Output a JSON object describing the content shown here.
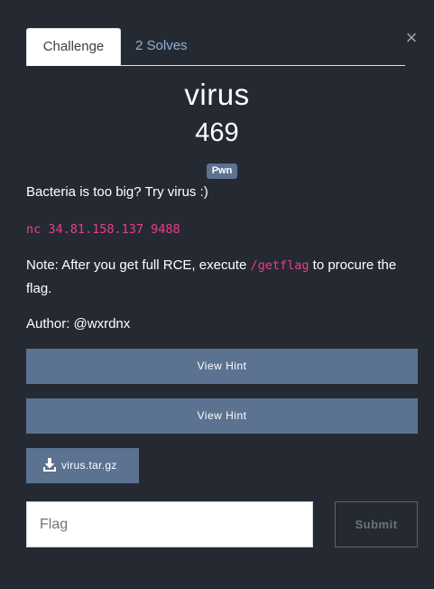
{
  "modal": {
    "close_glyph": "×"
  },
  "tabs": [
    {
      "label": "Challenge",
      "active": true
    },
    {
      "label": "2 Solves",
      "active": false
    }
  ],
  "challenge": {
    "name": "virus",
    "points": "469",
    "category_tag": "Pwn",
    "description": {
      "line1": "Bacteria is too big? Try virus :)",
      "connection": "nc 34.81.158.137 9488",
      "note_prefix": "Note: After you get full RCE, execute ",
      "note_code": "/getflag",
      "note_suffix": " to procure the flag.",
      "author": "Author: @wxrdnx"
    }
  },
  "hints": [
    {
      "label": "View Hint"
    },
    {
      "label": "View Hint"
    }
  ],
  "file": {
    "label": "virus.tar.gz",
    "icon": "download-icon"
  },
  "submit_form": {
    "flag_placeholder": "Flag",
    "flag_value": "",
    "submit_label": "Submit"
  },
  "colors": {
    "background": "#252a32",
    "button": "#5b7290",
    "tab_link": "#8fb2d9",
    "code": "#e83e8c"
  }
}
